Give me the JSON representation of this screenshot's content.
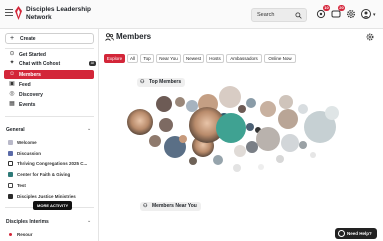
{
  "app": {
    "title": "Disciples Leadership Network",
    "title_line1": "Disciples Leadership",
    "title_line2": "Network"
  },
  "header": {
    "search_placeholder": "Search",
    "notifications_badge": "10",
    "messages_badge": "20"
  },
  "sidebar": {
    "create_label": "Create",
    "nav": [
      {
        "label": "Get Started",
        "icon": "compass-icon"
      },
      {
        "label": "Chat with Cohost",
        "icon": "sparkle-icon",
        "badge": "AI"
      },
      {
        "label": "Members",
        "icon": "members-icon",
        "active": true
      },
      {
        "label": "Feed",
        "icon": "feed-icon"
      },
      {
        "label": "Discovery",
        "icon": "discovery-icon"
      },
      {
        "label": "Events",
        "icon": "calendar-icon"
      }
    ],
    "section_general": "General",
    "channels": [
      {
        "label": "Welcome",
        "color": "#b9b9c9"
      },
      {
        "label": "Discussion",
        "color": "#5b6ba8"
      },
      {
        "label": "Thriving Congregations 2025 C...",
        "color": "#333333"
      },
      {
        "label": "Center for Faith & Giving",
        "color": "#2f7a78"
      },
      {
        "label": "Test",
        "color": "#444444"
      },
      {
        "label": "Disciples Justice Ministries",
        "color": "#2b2b2b"
      }
    ],
    "section_interims": "Disciples Interims",
    "interims_item": "Resour",
    "tooltip": "MORE ACTIVITY"
  },
  "main": {
    "title": "Members",
    "filters": [
      "Explore",
      "All",
      "Top",
      "Near You",
      "Newest",
      "Hosts",
      "Ambassadors",
      "Online Now"
    ],
    "group_top": "Top Members",
    "group_near": "Members Near You",
    "help_label": "Need Help?"
  },
  "colors": {
    "accent": "#d32639"
  }
}
